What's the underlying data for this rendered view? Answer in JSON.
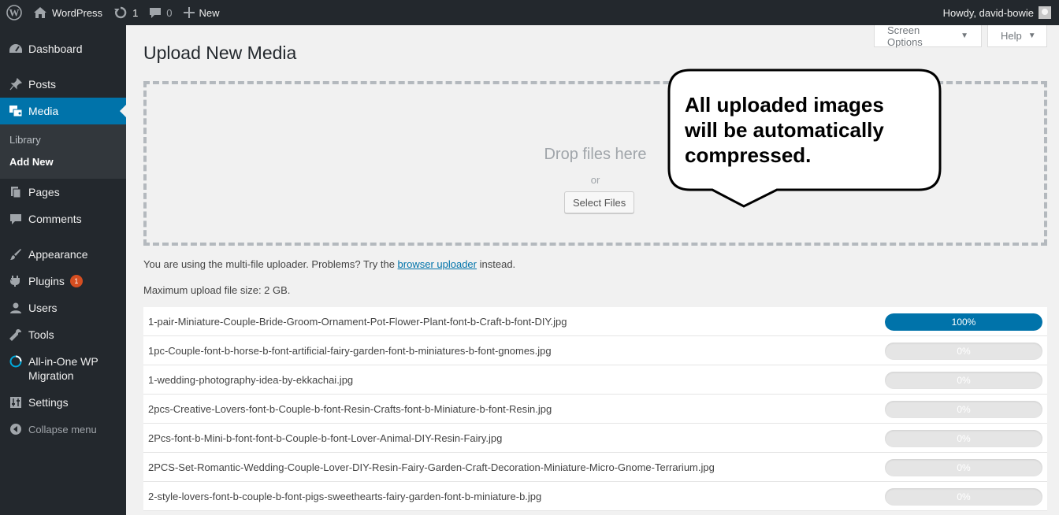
{
  "adminbar": {
    "site_name": "WordPress",
    "updates_count": "1",
    "comments_count": "0",
    "new_label": "New",
    "howdy": "Howdy, david-bowie"
  },
  "sidebar": {
    "dashboard": "Dashboard",
    "posts": "Posts",
    "media": "Media",
    "library": "Library",
    "add_new": "Add New",
    "pages": "Pages",
    "comments": "Comments",
    "appearance": "Appearance",
    "plugins": "Plugins",
    "plugins_badge": "1",
    "users": "Users",
    "tools": "Tools",
    "migration_line1": "All-in-One WP",
    "migration_line2": "Migration",
    "settings": "Settings",
    "collapse": "Collapse menu"
  },
  "screen_options": "Screen Options",
  "help": "Help",
  "page_title": "Upload New Media",
  "uploader": {
    "drop_label": "Drop files here",
    "or_label": "or",
    "select_button": "Select Files"
  },
  "callout_text": "All uploaded images will be automatically compressed.",
  "info": {
    "line1_prefix": "You are using the multi-file uploader. Problems? Try the",
    "line1_link": "browser uploader",
    "line1_suffix": "instead.",
    "max_size": "Maximum upload file size: 2 GB."
  },
  "media_items": [
    {
      "filename": "1-pair-Miniature-Couple-Bride-Groom-Ornament-Pot-Flower-Plant-font-b-Craft-b-font-DIY.jpg",
      "progress": 100,
      "percent": "100%"
    },
    {
      "filename": "1pc-Couple-font-b-horse-b-font-artificial-fairy-garden-font-b-miniatures-b-font-gnomes.jpg",
      "progress": 0,
      "percent": "0%"
    },
    {
      "filename": "1-wedding-photography-idea-by-ekkachai.jpg",
      "progress": 0,
      "percent": "0%"
    },
    {
      "filename": "2pcs-Creative-Lovers-font-b-Couple-b-font-Resin-Crafts-font-b-Miniature-b-font-Resin.jpg",
      "progress": 0,
      "percent": "0%"
    },
    {
      "filename": "2Pcs-font-b-Mini-b-font-font-b-Couple-b-font-Lover-Animal-DIY-Resin-Fairy.jpg",
      "progress": 0,
      "percent": "0%"
    },
    {
      "filename": "2PCS-Set-Romantic-Wedding-Couple-Lover-DIY-Resin-Fairy-Garden-Craft-Decoration-Miniature-Micro-Gnome-Terrarium.jpg",
      "progress": 0,
      "percent": "0%"
    },
    {
      "filename": "2-style-lovers-font-b-couple-b-font-pigs-sweethearts-fairy-garden-font-b-miniature-b.jpg",
      "progress": 0,
      "percent": "0%"
    }
  ]
}
